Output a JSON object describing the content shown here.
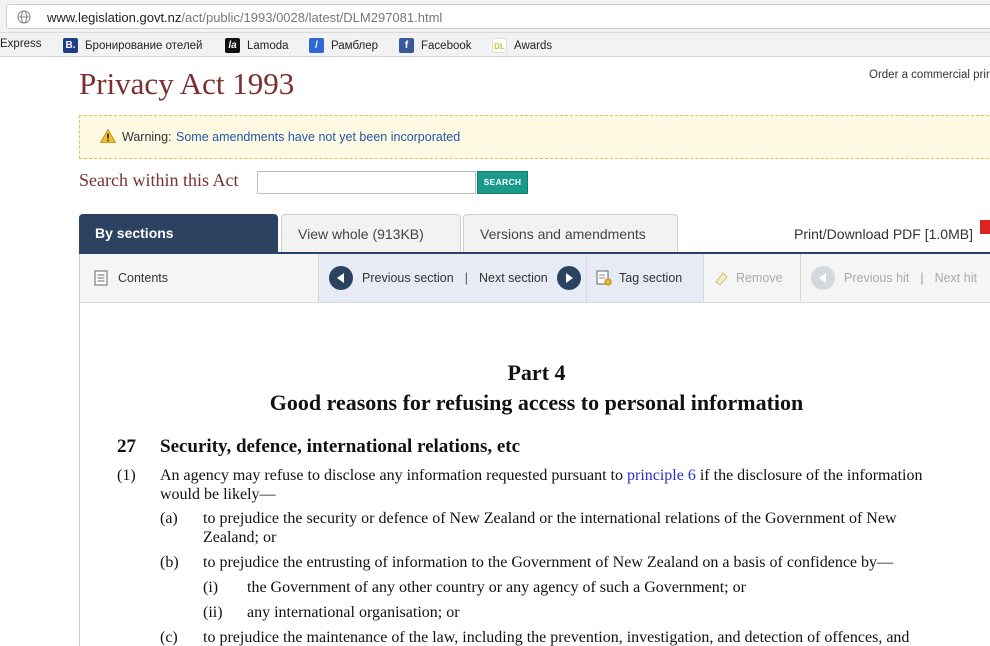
{
  "browser": {
    "url_host": "www.legislation.govt.nz",
    "url_path": "/act/public/1993/0028/latest/DLM297081.html"
  },
  "bookmarks": [
    {
      "label": "Express",
      "icon": ""
    },
    {
      "label": "Бронирование отелей",
      "icon": "B."
    },
    {
      "label": "Lamoda",
      "icon": "la"
    },
    {
      "label": "Рамблер",
      "icon": "/"
    },
    {
      "label": "Facebook",
      "icon": "f"
    },
    {
      "label": "Awards",
      "icon": "DL"
    }
  ],
  "header": {
    "title": "Privacy Act 1993",
    "order_link": "Order a commercial prin"
  },
  "warning": {
    "label": "Warning:",
    "link": "Some amendments have not yet been incorporated"
  },
  "search": {
    "label": "Search within this Act",
    "value": "",
    "button": "SEARCH"
  },
  "tabs": [
    {
      "label": "By sections",
      "active": true
    },
    {
      "label": "View whole (913KB)",
      "active": false
    },
    {
      "label": "Versions and amendments",
      "active": false
    }
  ],
  "print_link": "Print/Download PDF [1.0MB]",
  "toolbar": {
    "contents": "Contents",
    "previous_section": "Previous section",
    "separator": "|",
    "next_section": "Next section",
    "tag_section": "Tag section",
    "remove": "Remove",
    "previous_hit": "Previous hit",
    "next_hit": "Next hit"
  },
  "document": {
    "part": "Part 4",
    "part_title": "Good reasons for refusing access to personal information",
    "section_number": "27",
    "section_title": "Security, defence, international relations, etc",
    "sub1_num": "(1)",
    "sub1_text_before": "An agency may refuse to disclose any information requested pursuant to",
    "sub1_link": "principle 6",
    "sub1_text_after": "if the disclosure of the information",
    "sub1_line2": "would be likely—",
    "a_num": "(a)",
    "a_line1": "to prejudice the security or defence of New Zealand or the international relations of the Government of New",
    "a_line2": "Zealand; or",
    "b_num": "(b)",
    "b_line1": "to prejudice the entrusting of information to the Government of New Zealand on a basis of confidence by—",
    "i_num": "(i)",
    "i_text": "the Government of any other country or any agency of such a Government; or",
    "ii_num": "(ii)",
    "ii_text": "any international organisation; or",
    "c_num": "(c)",
    "c_line1": "to prejudice the maintenance of the law, including the prevention, investigation, and detection of offences, and"
  },
  "colors": {
    "title": "#7a3030",
    "tab_active": "#2b4261",
    "link": "#2158a6",
    "search_button": "#1a9a8c",
    "warning_bg": "#fef9e2"
  }
}
